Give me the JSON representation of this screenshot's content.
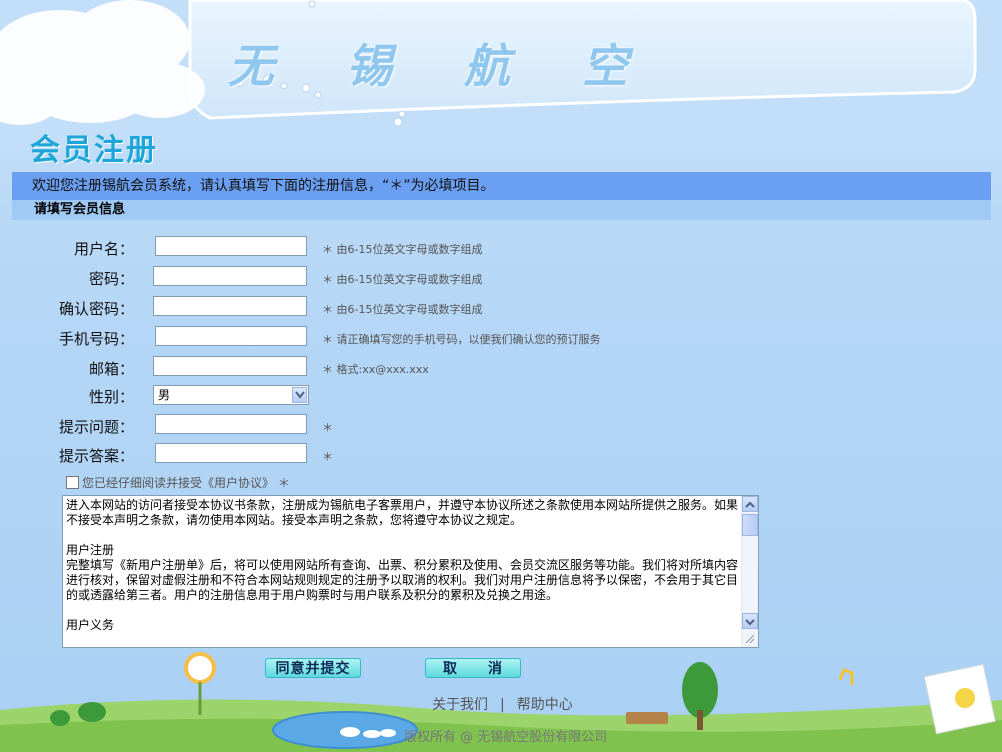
{
  "brand": "无 锡 航 空",
  "page_title": "会员注册",
  "welcome": "欢迎您注册锡航会员系统，请认真填写下面的注册信息，“＊”为必填项目。",
  "section_title": "请填写会员信息",
  "form": {
    "username": {
      "label": "用户名：",
      "hint": "＊ 由6-15位英文字母或数字组成",
      "value": ""
    },
    "password": {
      "label": "密码：",
      "hint": "＊ 由6-15位英文字母或数字组成",
      "value": ""
    },
    "confirm_password": {
      "label": "确认密码：",
      "hint": "＊ 由6-15位英文字母或数字组成",
      "value": ""
    },
    "phone": {
      "label": "手机号码：",
      "hint": "＊ 请正确填写您的手机号码，以便我们确认您的预订服务",
      "value": ""
    },
    "email": {
      "label": "邮箱：",
      "hint": "＊ 格式:xx@xxx.xxx",
      "value": ""
    },
    "gender": {
      "label": "性别：",
      "selected": "男"
    },
    "question": {
      "label": "提示问题：",
      "hint": "＊",
      "value": ""
    },
    "answer": {
      "label": "提示答案：",
      "hint": "＊",
      "value": ""
    }
  },
  "agree_label": "您已经仔细阅读并接受《用户协议》 ＊",
  "agreement": {
    "p1": "进入本网站的访问者接受本协议书条款，注册成为锡航电子客票用户，并遵守本协议所述之条款使用本网站所提供之服务。如果不接受本声明之条款，请勿使用本网站。接受本声明之条款，您将遵守本协议之规定。",
    "h2": "用户注册",
    "p2": "完整填写《新用户注册单》后，将可以使用网站所有查询、出票、积分累积及使用、会员交流区服务等功能。我们将对所填内容进行核对，保留对虚假注册和不符合本网站规则规定的注册予以取消的权利。我们对用户注册信息将予以保密，不会用于其它目的或透露给第三者。用户的注册信息用于用户购票时与用户联系及积分的累积及兑换之用途。",
    "h3": "用户义务"
  },
  "buttons": {
    "submit": "同意并提交",
    "cancel": "取　　消"
  },
  "footer": {
    "about": "关于我们",
    "separator": "|",
    "help": "帮助中心",
    "copyright": "版权所有 @ 无锡航空股份有限公司"
  }
}
